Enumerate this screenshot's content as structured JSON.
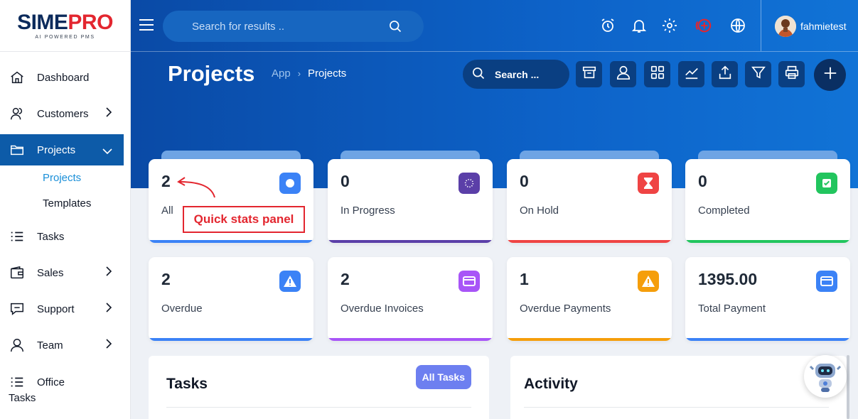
{
  "brand": {
    "name_part1": "SIME",
    "name_part2": "PRO",
    "tagline": "AI POWERED PMS"
  },
  "sidebar": {
    "items": [
      {
        "label": "Dashboard",
        "icon": "home-icon"
      },
      {
        "label": "Customers",
        "icon": "users-icon"
      },
      {
        "label": "Projects",
        "icon": "folder-icon"
      },
      {
        "label": "Tasks",
        "icon": "list-icon"
      },
      {
        "label": "Sales",
        "icon": "wallet-icon"
      },
      {
        "label": "Support",
        "icon": "chat-icon"
      },
      {
        "label": "Team",
        "icon": "user-icon"
      },
      {
        "label": "Office Tasks",
        "icon": "list-icon"
      }
    ],
    "sub_items": [
      {
        "label": "Projects"
      },
      {
        "label": "Templates"
      }
    ]
  },
  "topbar": {
    "search_placeholder": "Search for results ..",
    "username": "fahmietest"
  },
  "page": {
    "title": "Projects",
    "breadcrumb": [
      "App",
      "Projects"
    ],
    "search_placeholder": "Search ..."
  },
  "stats": [
    {
      "value": "2",
      "label": "All",
      "color": "#3b82f6",
      "icon": "globe-icon"
    },
    {
      "value": "0",
      "label": "In Progress",
      "color": "#5b3fa8",
      "icon": "spinner-icon"
    },
    {
      "value": "0",
      "label": "On Hold",
      "color": "#ef4444",
      "icon": "hourglass-icon"
    },
    {
      "value": "0",
      "label": "Completed",
      "color": "#22c55e",
      "icon": "check-icon"
    },
    {
      "value": "2",
      "label": "Overdue",
      "color": "#3b82f6",
      "icon": "warning-icon"
    },
    {
      "value": "2",
      "label": "Overdue Invoices",
      "color": "#a855f7",
      "icon": "card-icon"
    },
    {
      "value": "1",
      "label": "Overdue Payments",
      "color": "#f59e0b",
      "icon": "warning-icon"
    },
    {
      "value": "1395.00",
      "label": "Total Payment",
      "color": "#3b82f6",
      "icon": "card-icon"
    }
  ],
  "annotation": "Quick stats panel",
  "panels": {
    "tasks_title": "Tasks",
    "all_tasks_label": "All Tasks",
    "activity_title": "Activity"
  }
}
